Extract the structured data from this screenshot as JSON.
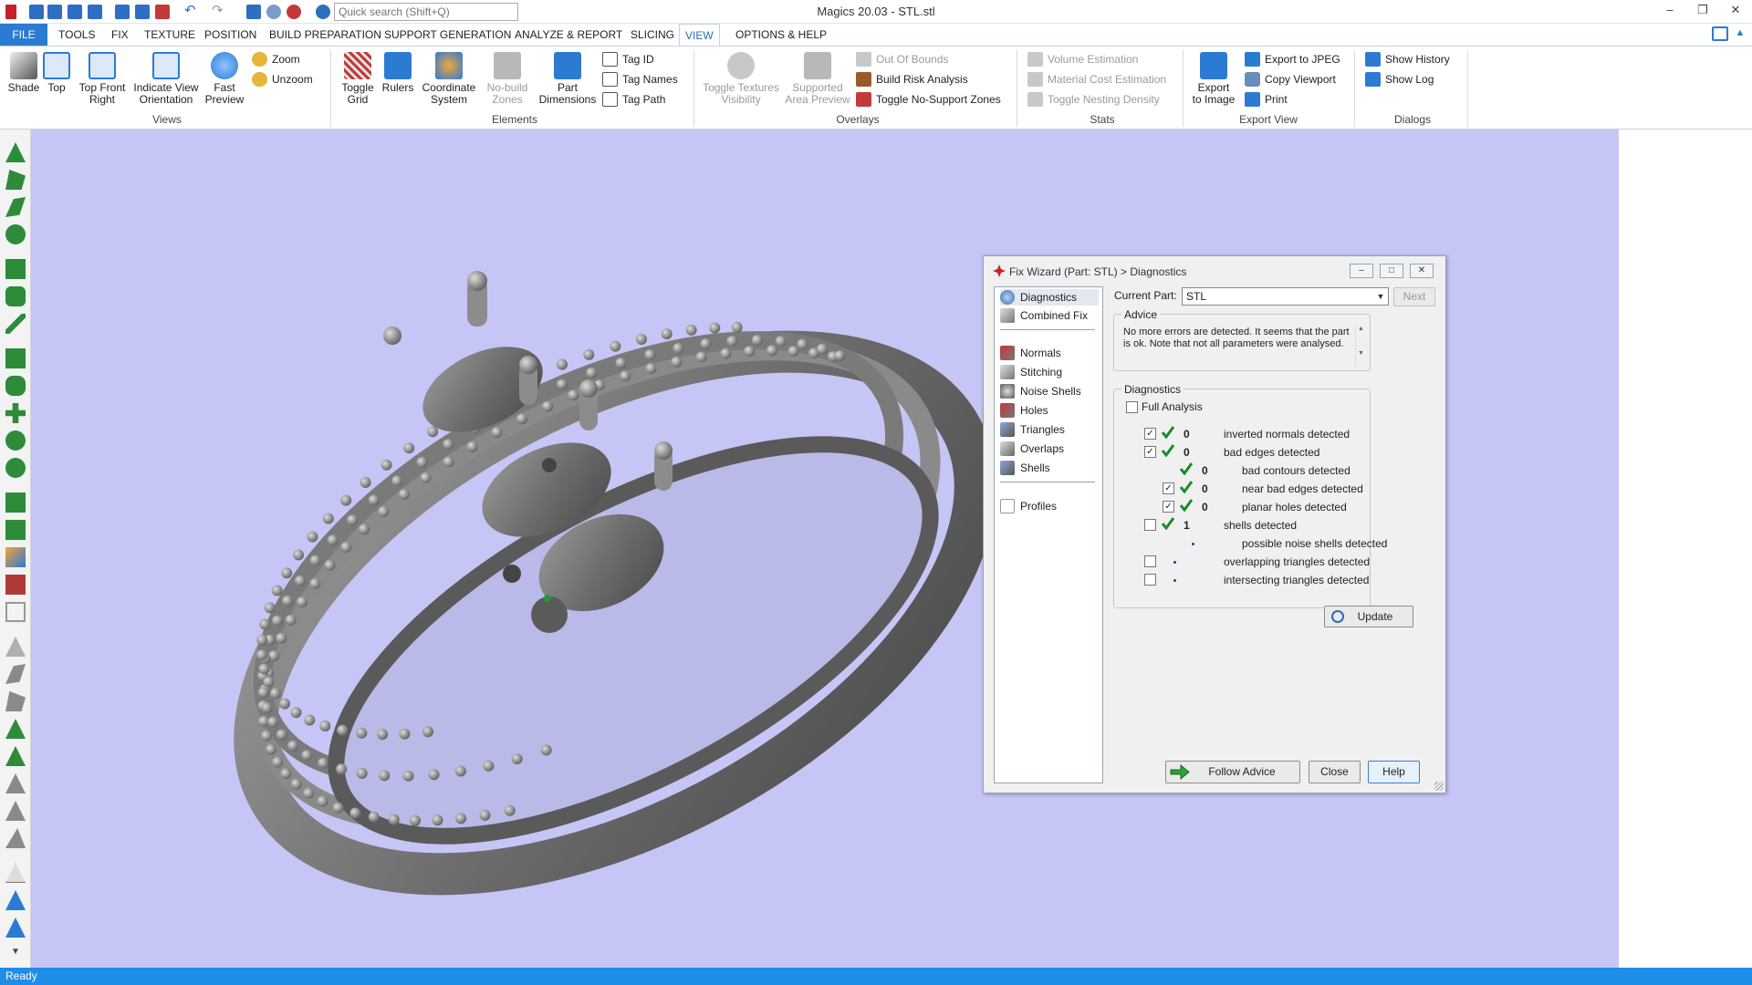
{
  "window": {
    "title": "Magics 20.03 - STL.stl",
    "search_placeholder": "Quick search (Shift+Q)"
  },
  "menu": {
    "tabs": [
      "FILE",
      "TOOLS",
      "FIX",
      "TEXTURE",
      "POSITION",
      "BUILD PREPARATION",
      "SUPPORT GENERATION",
      "ANALYZE & REPORT",
      "SLICING",
      "VIEW",
      "OPTIONS & HELP"
    ],
    "active": "VIEW"
  },
  "ribbon": {
    "views": {
      "label": "Views",
      "shade": "Shade",
      "top": "Top",
      "top_front_right_1": "Top Front",
      "top_front_right_2": "Right",
      "indicate_view_1": "Indicate View",
      "indicate_view_2": "Orientation",
      "fast_preview_1": "Fast",
      "fast_preview_2": "Preview",
      "zoom": "Zoom",
      "unzoom": "Unzoom"
    },
    "elements": {
      "label": "Elements",
      "toggle_grid_1": "Toggle",
      "toggle_grid_2": "Grid",
      "rulers": "Rulers",
      "coordinate_1": "Coordinate",
      "coordinate_2": "System",
      "nobuild_1": "No-build",
      "nobuild_2": "Zones",
      "part_dim_1": "Part",
      "part_dim_2": "Dimensions",
      "tag_id": "Tag ID",
      "tag_names": "Tag Names",
      "tag_path": "Tag Path"
    },
    "overlays": {
      "label": "Overlays",
      "toggle_textures_1": "Toggle Textures",
      "toggle_textures_2": "Visibility",
      "supported_area_1": "Supported",
      "supported_area_2": "Area Preview",
      "out_of_bounds": "Out Of Bounds",
      "build_risk": "Build Risk Analysis",
      "toggle_nosupport": "Toggle No-Support Zones"
    },
    "stats": {
      "label": "Stats",
      "volume": "Volume Estimation",
      "material_cost": "Material Cost Estimation",
      "nesting_density": "Toggle Nesting Density"
    },
    "export_view": {
      "label": "Export View",
      "export_image_1": "Export",
      "export_image_2": "to Image",
      "export_jpeg": "Export to JPEG",
      "copy_viewport": "Copy Viewport",
      "print": "Print"
    },
    "dialogs": {
      "label": "Dialogs",
      "show_history": "Show History",
      "show_log": "Show Log"
    }
  },
  "status": "Ready",
  "colors": {
    "accent": "#2b7bd3",
    "status_bar": "#1f8ee9",
    "viewport_bg": "#c5c6f6",
    "check_green": "#1a8a2a"
  },
  "dialog": {
    "title": "Fix Wizard (Part: STL) > Diagnostics",
    "nav": {
      "diagnostics": "Diagnostics",
      "combined_fix": "Combined Fix",
      "normals": "Normals",
      "stitching": "Stitching",
      "noise_shells": "Noise Shells",
      "holes": "Holes",
      "triangles": "Triangles",
      "overlaps": "Overlaps",
      "shells": "Shells",
      "profiles": "Profiles"
    },
    "current_part_label": "Current Part:",
    "current_part_value": "STL",
    "next_label": "Next",
    "advice_label": "Advice",
    "advice_text": "No more errors are detected. It seems that the part is ok. Note that not all parameters were analysed.",
    "diagnostics_label": "Diagnostics",
    "full_analysis_label": "Full Analysis",
    "rows": {
      "inverted_normals": {
        "count": "0",
        "text": "inverted normals detected"
      },
      "bad_edges": {
        "count": "0",
        "text": "bad edges detected"
      },
      "bad_contours": {
        "count": "0",
        "text": "bad contours detected"
      },
      "near_bad_edges": {
        "count": "0",
        "text": "near bad edges detected"
      },
      "planar_holes": {
        "count": "0",
        "text": "planar holes detected"
      },
      "shells": {
        "count": "1",
        "text": "shells detected"
      },
      "noise_shells": {
        "text": "possible noise shells detected"
      },
      "overlapping": {
        "text": "overlapping triangles detected"
      },
      "intersecting": {
        "text": "intersecting triangles detected"
      }
    },
    "update_label": "Update",
    "follow_advice_label": "Follow Advice",
    "close_label": "Close",
    "help_label": "Help"
  }
}
